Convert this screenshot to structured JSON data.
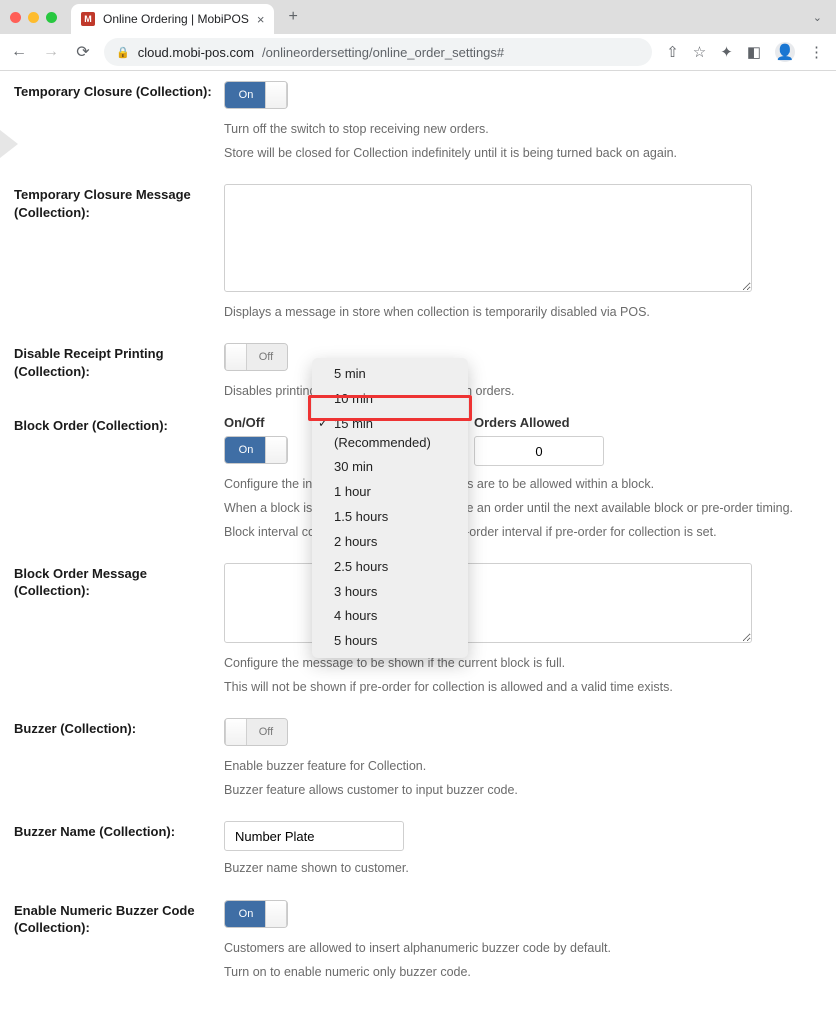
{
  "browser": {
    "tab_title": "Online Ordering | MobiPOS",
    "favicon_letter": "M",
    "url_domain": "cloud.mobi-pos.com",
    "url_path": "/onlineordersetting/online_order_settings#"
  },
  "temporary_closure": {
    "label": "Temporary Closure (Collection):",
    "toggle_state": "On",
    "help1": "Turn off the switch to stop receiving new orders.",
    "help2": "Store will be closed for Collection indefinitely until it is being turned back on again."
  },
  "temporary_closure_message": {
    "label": "Temporary Closure Message (Collection):",
    "value": "",
    "help1": "Displays a message in store when collection is temporarily disabled via POS."
  },
  "disable_receipt": {
    "label": "Disable Receipt Printing (Collection):",
    "toggle_state": "Off",
    "help1": "Disables printing of receipt for paid collection orders."
  },
  "block_order": {
    "label": "Block Order (Collection):",
    "col_onoff": "On/Off",
    "col_interval_hidden": "",
    "col_orders": "Orders Allowed",
    "toggle_state": "On",
    "orders_allowed": "0",
    "help1": "Configure the interval period for which orders are to be allowed within a block.",
    "help2": "When a block is full, customer can only place an order until the next available block or pre-order timing.",
    "help3": "Block interval configured here overrides pre-order interval if pre-order for collection is set.",
    "interval_options": [
      "5 min",
      "10 min",
      "15 min (Recommended)",
      "30 min",
      "1 hour",
      "1.5 hours",
      "2 hours",
      "2.5 hours",
      "3 hours",
      "4 hours",
      "5 hours"
    ],
    "interval_selected_index": 2
  },
  "block_order_message": {
    "label": "Block Order Message (Collection):",
    "value": "",
    "help1": "Configure the message to be shown if the current block is full.",
    "help2": "This will not be shown if pre-order for collection is allowed and a valid time exists."
  },
  "buzzer": {
    "label": "Buzzer (Collection):",
    "toggle_state": "Off",
    "help1": "Enable buzzer feature for Collection.",
    "help2": "Buzzer feature allows customer to input buzzer code."
  },
  "buzzer_name": {
    "label": "Buzzer Name (Collection):",
    "value": "Number Plate",
    "help1": "Buzzer name shown to customer."
  },
  "numeric_buzzer": {
    "label": "Enable Numeric Buzzer Code (Collection):",
    "toggle_state": "On",
    "help1": "Customers are allowed to insert alphanumeric buzzer code by default.",
    "help2": "Turn on to enable numeric only buzzer code."
  },
  "toggle_labels": {
    "on": "On",
    "off": "Off"
  }
}
